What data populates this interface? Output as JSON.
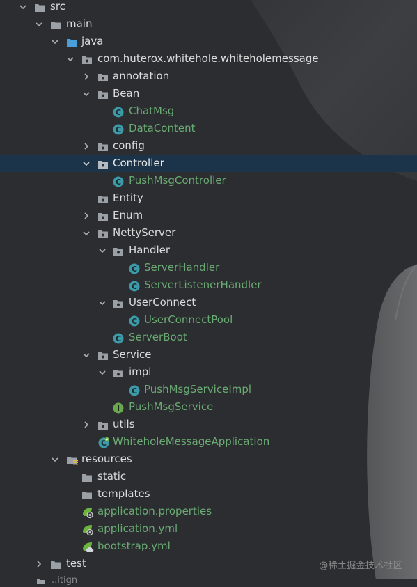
{
  "tree": {
    "src": "src",
    "main": "main",
    "java": "java",
    "package": "com.huterox.whitehole.whiteholemessage",
    "annotation": "annotation",
    "bean": "Bean",
    "chat_msg": "ChatMsg",
    "data_content": "DataContent",
    "config": "config",
    "controller": "Controller",
    "push_msg_controller": "PushMsgController",
    "entity": "Entity",
    "enum": "Enum",
    "netty_server": "NettyServer",
    "handler": "Handler",
    "server_handler": "ServerHandler",
    "server_listener_handler": "ServerListenerHandler",
    "user_connect": "UserConnect",
    "user_connect_pool": "UserConnectPool",
    "server_boot": "ServerBoot",
    "service": "Service",
    "impl": "impl",
    "push_msg_service_impl": "PushMsgServiceImpl",
    "push_msg_service": "PushMsgService",
    "utils": "utils",
    "application_class": "WhiteholeMessageApplication",
    "resources": "resources",
    "static": "static",
    "templates": "templates",
    "application_properties": "application.properties",
    "application_yml": "application.yml",
    "bootstrap_yml": "bootstrap.yml",
    "test": "test",
    "partial_next": "..itign"
  },
  "watermark": "@稀土掘金技术社区",
  "colors": {
    "background": "#2b2d30",
    "selected_row": "#1c3449",
    "class_name_green": "#6aab73",
    "folder_gray": "#9aa0a6",
    "source_folder_blue": "#4a9fd8",
    "class_icon_teal": "#3d9aa8",
    "interface_icon_green": "#6aa84f",
    "spring_green": "#6db33f"
  }
}
